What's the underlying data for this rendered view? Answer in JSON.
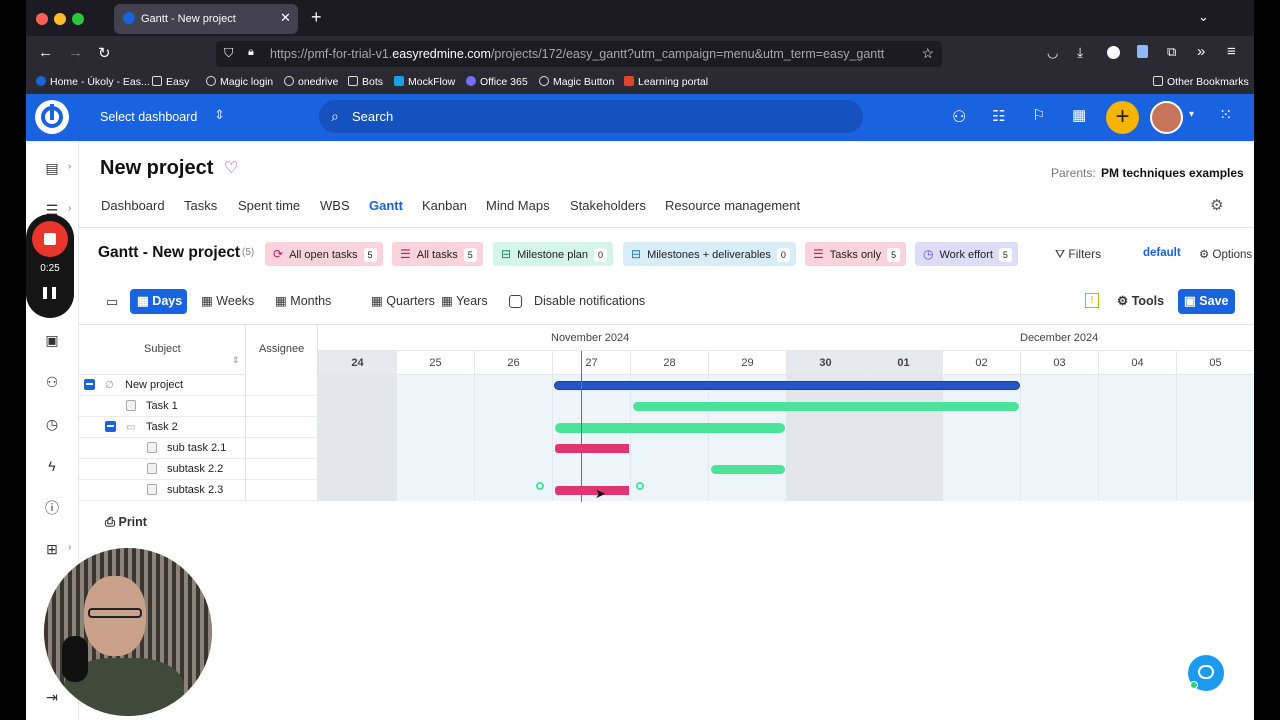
{
  "browser": {
    "tab_title": "Gantt - New project",
    "url_prefix": "https://pmf-for-trial-v1.",
    "url_domain": "easyredmine.com",
    "url_path": "/projects/172/easy_gantt?utm_campaign=menu&utm_term=easy_gantt",
    "bookmarks": [
      "Home - Úkoly - Eas...",
      "Easy",
      "Magic login",
      "onedrive",
      "Bots",
      "MockFlow",
      "Office 365",
      "Magic Button",
      "Learning portal"
    ],
    "other_bookmarks": "Other Bookmarks"
  },
  "app": {
    "select_dashboard": "Select dashboard",
    "search_placeholder": "Search",
    "accent": "#1a63e0"
  },
  "recorder": {
    "time": "0:25"
  },
  "project": {
    "title": "New project",
    "parents_label": "Parents:",
    "parents_value": "PM techniques examples",
    "tabs": [
      "Dashboard",
      "Tasks",
      "Spent time",
      "WBS",
      "Gantt",
      "Kanban",
      "Mind Maps",
      "Stakeholders",
      "Resource management"
    ],
    "active_tab": "Gantt"
  },
  "gantt": {
    "title": "Gantt - New project",
    "count": "(5)",
    "filters": [
      {
        "label": "All open tasks",
        "count": "5",
        "bg": "#fbd3de"
      },
      {
        "label": "All tasks",
        "count": "5",
        "bg": "#fbd3de"
      },
      {
        "label": "Milestone plan",
        "count": "0",
        "bg": "#d5f5ea"
      },
      {
        "label": "Milestones + deliverables",
        "count": "0",
        "bg": "#d7eef8"
      },
      {
        "label": "Tasks only",
        "count": "5",
        "bg": "#fbd3de"
      },
      {
        "label": "Work effort",
        "count": "5",
        "bg": "#dfdcf9"
      }
    ],
    "filters_btn": "Filters",
    "default_link": "default",
    "options_btn": "Options",
    "zoom": [
      "Days",
      "Weeks",
      "Months",
      "Quarters",
      "Years"
    ],
    "active_zoom": "Days",
    "disable_notifications": "Disable notifications",
    "tools_btn": "Tools",
    "save_btn": "Save",
    "col_subject": "Subject",
    "col_assignee": "Assignee",
    "months": [
      "November 2024",
      "December 2024"
    ],
    "days": [
      "24",
      "25",
      "26",
      "27",
      "28",
      "29",
      "30",
      "01",
      "02",
      "03",
      "04",
      "05"
    ],
    "rows": [
      {
        "name": "New project",
        "color": "#2456c7",
        "start": 3,
        "end": 9
      },
      {
        "name": "Task 1",
        "color": "#4ae39a",
        "start": 4,
        "end": 9
      },
      {
        "name": "Task 2",
        "color": "#4ae39a",
        "start": 3,
        "end": 6
      },
      {
        "name": "sub task 2.1",
        "color": "#e0356e",
        "start": 3,
        "end": 4
      },
      {
        "name": "subtask 2.2",
        "color": "#4ae39a",
        "start": 5,
        "end": 6
      },
      {
        "name": "subtask 2.3",
        "color": "#e0356e",
        "start": 3,
        "end": 4
      }
    ],
    "print": "Print"
  }
}
